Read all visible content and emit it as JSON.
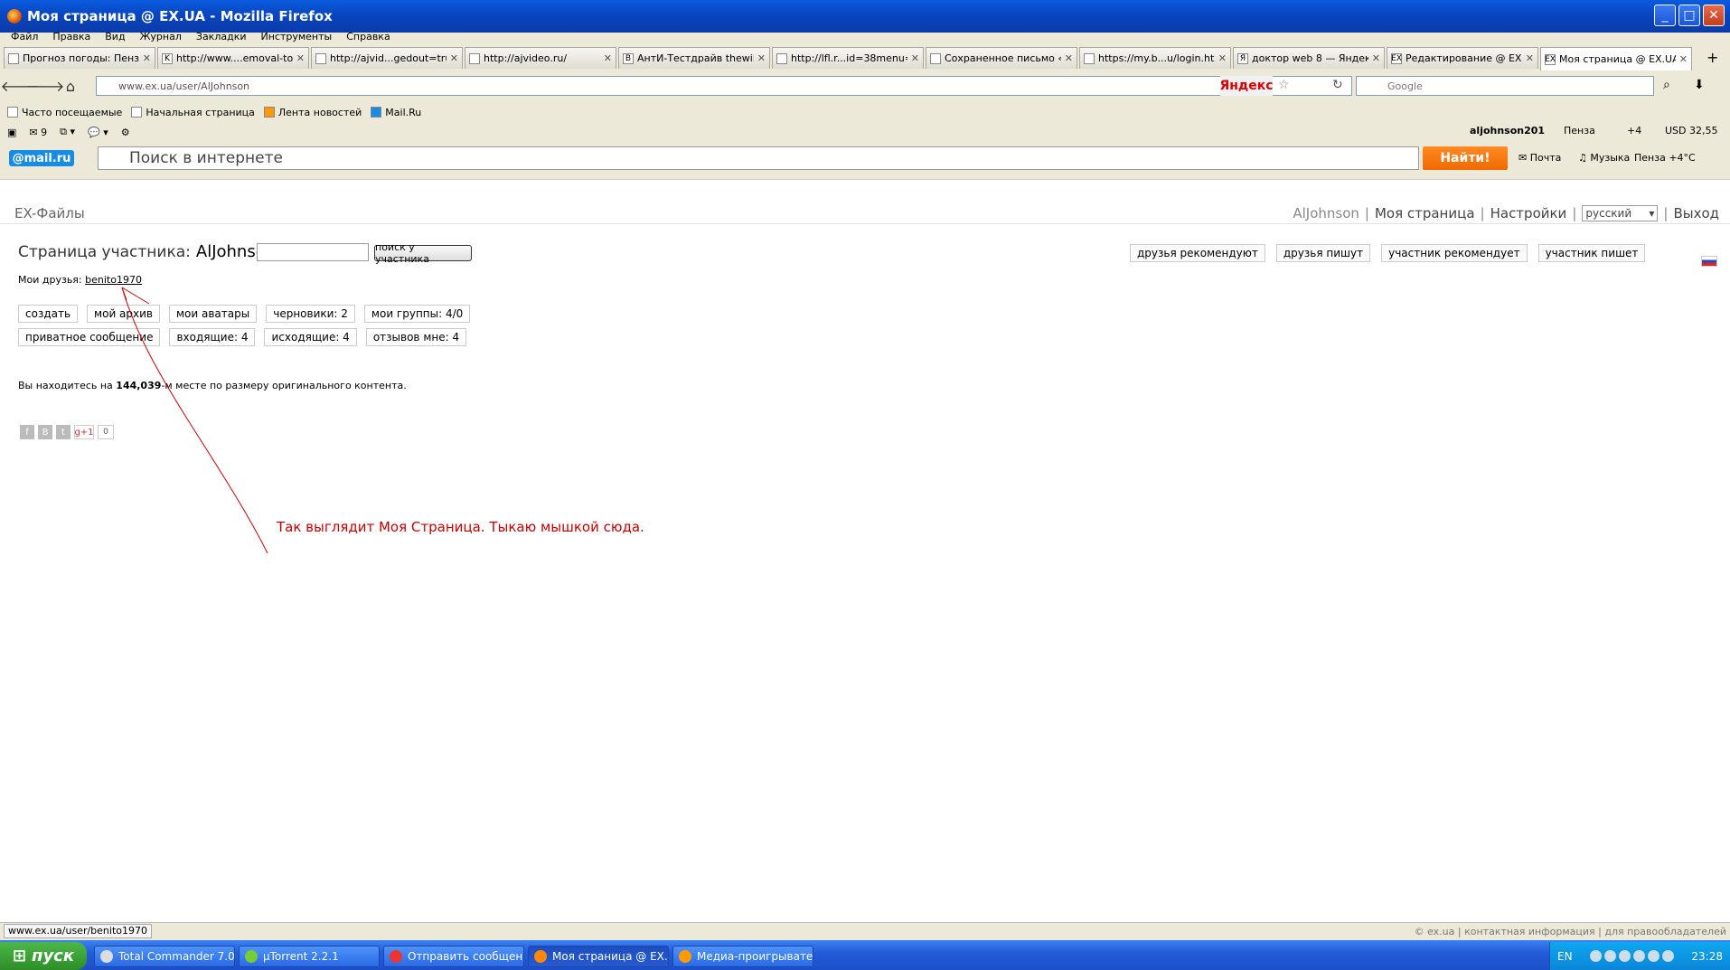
{
  "window": {
    "title": "Моя страница @ EX.UA - Mozilla Firefox"
  },
  "menu": [
    "Файл",
    "Правка",
    "Вид",
    "Журнал",
    "Закладки",
    "Инструменты",
    "Справка"
  ],
  "tabs": [
    {
      "label": "Прогноз погоды: Пенз..."
    },
    {
      "label": "http://www....emoval-tool"
    },
    {
      "label": "http://ajvid...gedout=true"
    },
    {
      "label": "http://ajvideo.ru/"
    },
    {
      "label": "АнтИ-Тестдрайв thewik..."
    },
    {
      "label": "http://lfl.r...id=38menu=3"
    },
    {
      "label": "Сохраненное письмо «(..."
    },
    {
      "label": "https://my.b...u/login.html"
    },
    {
      "label": "доктор web 8 — Яндек..."
    },
    {
      "label": "Редактирование @ EX...."
    },
    {
      "label": "Моя страница @ EX.UA"
    }
  ],
  "nav": {
    "url": "www.ex.ua/user/AlJohnson",
    "yandex": "Яндекс",
    "search_placeholder": "Google"
  },
  "bookmarks": [
    "Часто посещаемые",
    "Начальная страница",
    "Лента новостей",
    "Mail.Ru"
  ],
  "toolbar2": {
    "mail_count": "9"
  },
  "mailru": {
    "logo": "@mail.ru",
    "search_placeholder": "Поиск в интернете",
    "find": "Найти!",
    "mail": "Почта",
    "music": "Музыка",
    "weather": "Пенза +4°C",
    "user": "aljohnson201",
    "city": "Пенза",
    "temp": "+4",
    "currency": "USD 32,55"
  },
  "site": {
    "brand": "EX-Файлы",
    "nav": {
      "user": "AlJohnson",
      "my_page": "Моя страница",
      "settings": "Настройки",
      "lang": "русский",
      "logout": "Выход"
    },
    "page_title_prefix": "Страница участника:",
    "page_title_user": "AlJohnson",
    "member_search_btn": "поиск у участника",
    "right_buttons": [
      "друзья рекомендуют",
      "друзья пишут",
      "участник рекомендует",
      "участник пишет"
    ],
    "friends_label": "Мои друзья:",
    "friend": "benito1970",
    "row1": [
      "создать",
      "мой архив",
      "мои аватары",
      "черновики: 2",
      "мои группы: 4/0"
    ],
    "row2": [
      "приватное сообщение",
      "входящие: 4",
      "исходящие: 4",
      "отзывов мне: 4"
    ],
    "rank_prefix": "Вы находитесь на",
    "rank_value": "144,039",
    "rank_suffix": "-м месте по размеру оригинального контента.",
    "social": [
      "f",
      "B",
      "t",
      "g+1"
    ],
    "social_count": "0",
    "annotation": "Так выглядит Моя Страница. Тыкаю мышкой сюда."
  },
  "statusbar": {
    "url": "www.ex.ua/user/benito1970",
    "footer": "© ex.ua | контактная информация | для правообладателей"
  },
  "taskbar": {
    "start": "пуск",
    "items": [
      "Total Commander 7.0...",
      "µTorrent 2.2.1",
      "Отправить сообщен...",
      "Моя страница @ EX....",
      "Медиа-проигрывате..."
    ],
    "lang": "EN",
    "time": "23:28"
  }
}
